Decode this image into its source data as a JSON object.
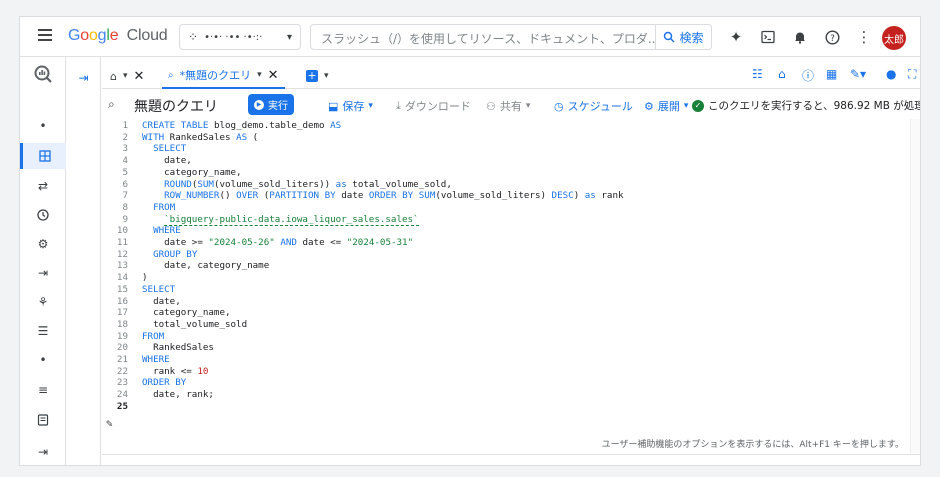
{
  "header": {
    "logo_google": "Google",
    "logo_cloud": "Cloud",
    "project_name": "•·•· ·•• ·•·:·",
    "search_placeholder": "スラッシュ（/）を使用してリソース、ドキュメント、プロダ...",
    "search_button": "検索",
    "avatar": "太郎"
  },
  "tabs": {
    "query_tab_label": "*無題のクエリ"
  },
  "toolbar": {
    "title": "無題のクエリ",
    "run": "実行",
    "save": "保存",
    "download": "ダウンロード",
    "share": "共有",
    "schedule": "スケジュール",
    "expand": "展開",
    "status": "このクエリを実行すると、986.92 MB が処理..."
  },
  "editor": {
    "lines": [
      "CREATE TABLE blog_demo.table_demo AS",
      "WITH RankedSales AS (",
      "  SELECT",
      "    date,",
      "    category_name,",
      "    ROUND(SUM(volume_sold_liters)) as total_volume_sold,",
      "    ROW_NUMBER() OVER (PARTITION BY date ORDER BY SUM(volume_sold_liters) DESC) as rank",
      "  FROM",
      "    `bigquery-public-data.iowa_liquor_sales.sales`",
      "  WHERE",
      "    date >= \"2024-05-26\" AND date <= \"2024-05-31\"",
      "  GROUP BY",
      "    date, category_name",
      ")",
      "SELECT",
      "  date,",
      "  category_name,",
      "  total_volume_sold",
      "FROM",
      "  RankedSales",
      "WHERE",
      "  rank <= 10",
      "ORDER BY",
      "  date, rank;",
      ""
    ],
    "line_numbers": [
      "1",
      "2",
      "3",
      "4",
      "5",
      "6",
      "7",
      "8",
      "9",
      "10",
      "11",
      "12",
      "13",
      "14",
      "15",
      "16",
      "17",
      "18",
      "19",
      "20",
      "21",
      "22",
      "23",
      "24",
      "25"
    ],
    "accessibility_hint": "ユーザー補助機能のオプションを表示するには、Alt+F1 キーを押します。"
  }
}
